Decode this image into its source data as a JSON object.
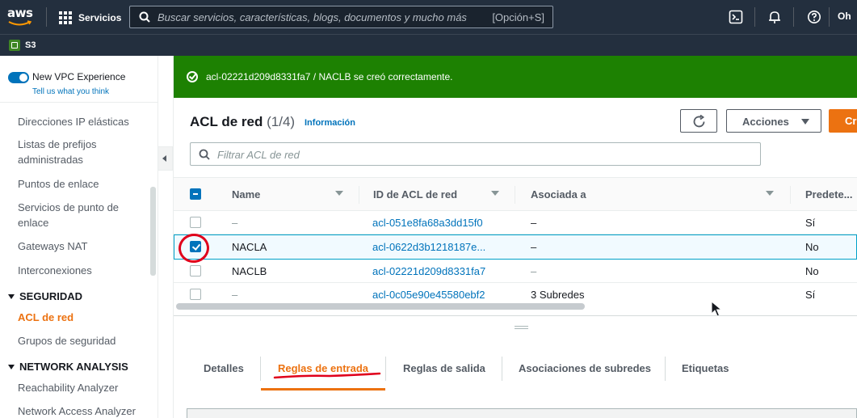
{
  "topnav": {
    "logo_text": "aws",
    "services_label": "Servicios",
    "search_placeholder": "Buscar servicios, características, blogs, documentos y mucho más",
    "search_shortcut": "[Opción+S]",
    "right_text": "Oh"
  },
  "subnav": {
    "service_label": "S3"
  },
  "sidebar": {
    "vpc_toggle_label": "New VPC Experience",
    "vpc_link": "Tell us what you think",
    "items": [
      {
        "label": "Direcciones IP elásticas"
      },
      {
        "label": "Listas de prefijos administradas"
      },
      {
        "label": "Puntos de enlace"
      },
      {
        "label": "Servicios de punto de enlace"
      },
      {
        "label": "Gateways NAT"
      },
      {
        "label": "Interconexiones"
      }
    ],
    "section_security": "SEGURIDAD",
    "security_items": [
      {
        "label": "ACL de red",
        "active": true
      },
      {
        "label": "Grupos de seguridad"
      }
    ],
    "section_network": "NETWORK ANALYSIS",
    "network_items": [
      {
        "label": "Reachability Analyzer"
      },
      {
        "label": "Network Access Analyzer"
      }
    ]
  },
  "flash": {
    "message": "acl-02221d209d8331fa7 / NACLB se creó correctamente."
  },
  "header": {
    "title": "ACL de red",
    "count": "(1/4)",
    "info_link": "Información",
    "actions_label": "Acciones",
    "create_label": "Crear ACL de red"
  },
  "filter": {
    "placeholder": "Filtrar ACL de red"
  },
  "table": {
    "columns": [
      "Name",
      "ID de ACL de red",
      "Asociada a",
      "Predete..."
    ],
    "rows": [
      {
        "name": "–",
        "id": "acl-051e8fa68a3dd15f0",
        "associated": "–",
        "default": "Sí",
        "selected": false
      },
      {
        "name": "NACLA",
        "id": "acl-0622d3b1218187e...",
        "associated": "–",
        "default": "No",
        "selected": true
      },
      {
        "name": "NACLB",
        "id": "acl-02221d209d8331fa7",
        "associated": "–",
        "default": "No",
        "selected": false
      },
      {
        "name": "–",
        "id": "acl-0c05e90e45580ebf2",
        "associated": "3 Subredes",
        "default": "Sí",
        "selected": false
      }
    ]
  },
  "tabs": {
    "items": [
      "Detalles",
      "Reglas de entrada",
      "Reglas de salida",
      "Asociaciones de subredes",
      "Etiquetas"
    ],
    "active": "Reglas de entrada"
  },
  "colors": {
    "nav_bg": "#232f3e",
    "accent": "#ec7211",
    "link": "#0073bb",
    "success": "#1d8102",
    "annotation": "#e0001b"
  }
}
